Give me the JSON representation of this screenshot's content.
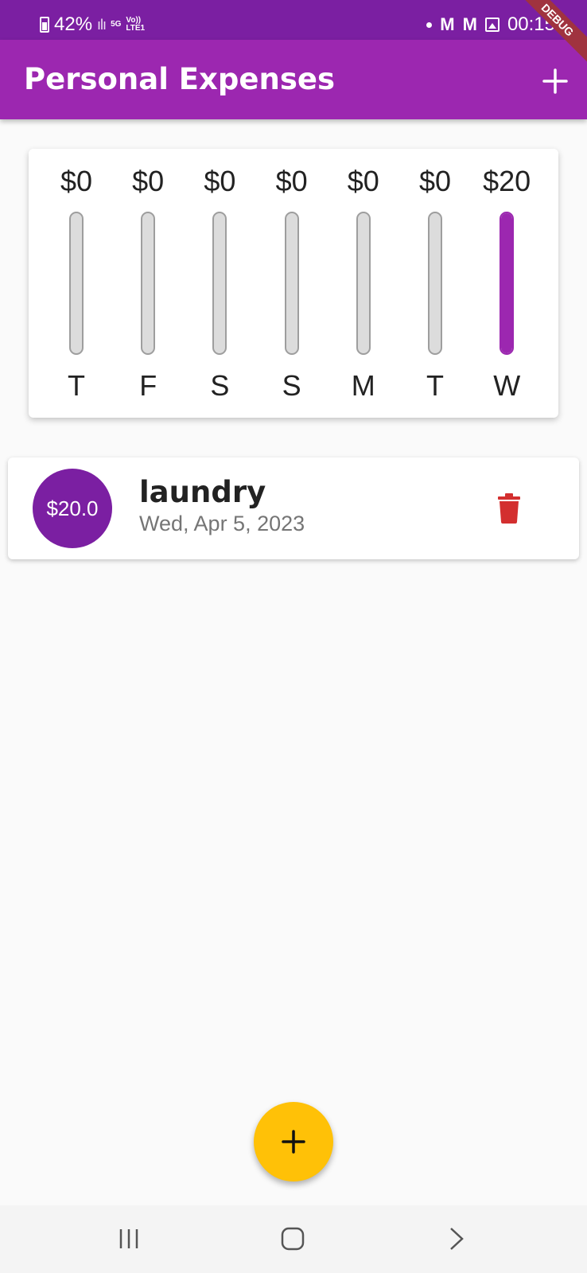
{
  "status_bar": {
    "battery": "42%",
    "network_top": "5G",
    "network_volte": "Vo))",
    "network_lte": "LTE1",
    "notif_m1": "M",
    "notif_m2": "M",
    "time": "00:15"
  },
  "debug_banner": "DEBUG",
  "app_bar": {
    "title": "Personal Expenses",
    "add_icon": "plus-icon"
  },
  "chart_data": {
    "type": "bar",
    "categories": [
      "T",
      "F",
      "S",
      "S",
      "M",
      "T",
      "W"
    ],
    "values": [
      0,
      0,
      0,
      0,
      0,
      0,
      20
    ],
    "value_labels": [
      "$0",
      "$0",
      "$0",
      "$0",
      "$0",
      "$0",
      "$20"
    ],
    "fill_fraction": [
      0,
      0,
      0,
      0,
      0,
      0,
      1
    ],
    "title": "",
    "xlabel": "",
    "ylabel": "",
    "bar_color": "#9c27b0",
    "track_color": "#dcdcdc"
  },
  "transactions": [
    {
      "amount": "$20.0",
      "title": "laundry",
      "date": "Wed, Apr 5, 2023",
      "delete_icon": "trash-icon"
    }
  ],
  "fab": {
    "icon": "plus-icon",
    "color": "#ffc107"
  },
  "nav_bar": {
    "icons": [
      "recent-apps-icon",
      "home-icon",
      "back-icon"
    ]
  },
  "colors": {
    "primary": "#9c27b0",
    "primary_dark": "#7b1fa2",
    "accent": "#ffc107",
    "delete": "#d32f2f"
  }
}
